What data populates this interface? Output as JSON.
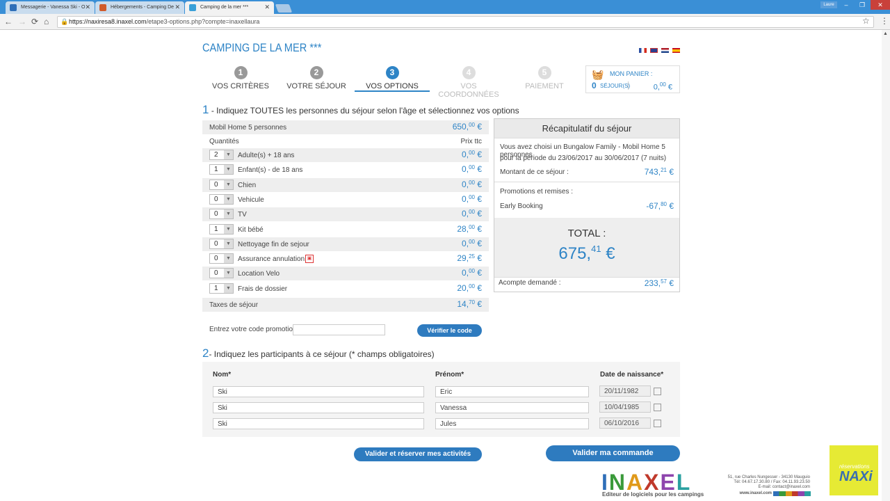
{
  "browser": {
    "tabs": [
      {
        "title": "Messagerie - Vanessa Ski - O",
        "color": "#2f6fb8"
      },
      {
        "title": "Hébergements - Camping De",
        "color": "#d05b2b"
      },
      {
        "title": "Camping de la mer ***",
        "color": "#3aa0d8"
      }
    ],
    "window_controls": [
      "Laure",
      "–",
      "❐",
      "✕"
    ],
    "url_host": "https://naxiresa8.inaxel.com",
    "url_path": "/etape3-options.php?compte=inaxellaura",
    "nav": {
      "back": "←",
      "forward": "→",
      "reload": "⟳",
      "home": "⌂",
      "star": "☆",
      "menu": "⋮"
    }
  },
  "page": {
    "title": "CAMPING DE LA MER ***",
    "flags": [
      "fr",
      "en",
      "nl",
      "es"
    ],
    "steps": [
      {
        "num": "1",
        "label": "VOS CRITÈRES",
        "state": "done"
      },
      {
        "num": "2",
        "label": "VOTRE SÉJOUR",
        "state": "done"
      },
      {
        "num": "3",
        "label": "VOS OPTIONS",
        "state": "current"
      },
      {
        "num": "4",
        "label": "VOS COORDONNÉES",
        "state": "off"
      },
      {
        "num": "5",
        "label": "PAIEMENT",
        "state": "off"
      }
    ],
    "cart": {
      "label": "MON PANIER :",
      "count": "0",
      "sejours": "SÉJOUR(S)",
      "price_int": "0,",
      "price_dec": "00",
      "currency": "€",
      "icon": "basket-icon"
    }
  },
  "section1": {
    "num": "1",
    "title": "- Indiquez TOUTES les personnes du séjour selon l'âge et sélectionnez vos options",
    "rental": {
      "label": "Mobil Home 5 personnes",
      "price_int": "650,",
      "price_dec": "00",
      "currency": "€"
    },
    "col_qty": "Quantités",
    "col_price": "Prix ttc",
    "options": [
      {
        "qty": "2",
        "label": "Adulte(s) + 18 ans",
        "price_int": "0,",
        "price_dec": "00"
      },
      {
        "qty": "1",
        "label": "Enfant(s) - de 18 ans",
        "price_int": "0,",
        "price_dec": "00"
      },
      {
        "qty": "0",
        "label": "Chien",
        "price_int": "0,",
        "price_dec": "00"
      },
      {
        "qty": "0",
        "label": "Vehicule",
        "price_int": "0,",
        "price_dec": "00"
      },
      {
        "qty": "0",
        "label": "TV",
        "price_int": "0,",
        "price_dec": "00"
      },
      {
        "qty": "1",
        "label": "Kit bébé",
        "price_int": "28,",
        "price_dec": "00"
      },
      {
        "qty": "0",
        "label": "Nettoyage fin de sejour",
        "price_int": "0,",
        "price_dec": "00"
      },
      {
        "qty": "0",
        "label": "Assurance annulation",
        "price_int": "29,",
        "price_dec": "25"
      },
      {
        "qty": "0",
        "label": "Location Velo",
        "price_int": "0,",
        "price_dec": "00"
      },
      {
        "qty": "1",
        "label": "Frais de dossier",
        "price_int": "20,",
        "price_dec": "00"
      }
    ],
    "taxes": {
      "label": "Taxes de séjour",
      "price_int": "14,",
      "price_dec": "70"
    },
    "currency": "€",
    "promo_label": "Entrez votre code promotion :",
    "promo_value": "",
    "promo_button": "Vérifier le code"
  },
  "recap": {
    "title": "Récapitulatif du séjour",
    "desc_line1": "Vous avez choisi un Bungalow Family - Mobil Home 5 personnes",
    "desc_line2": "pour la période du 23/06/2017 au 30/06/2017 (7 nuits)",
    "montant_label": "Montant de ce séjour :",
    "montant_int": "743,",
    "montant_dec": "21",
    "promos_label": "Promotions et remises :",
    "early_label": "Early Booking",
    "early_int": "-67,",
    "early_dec": "80",
    "total_label": "TOTAL :",
    "total_int": "675,",
    "total_dec": "41",
    "acompte_label": "Acompte demandé :",
    "acompte_int": "233,",
    "acompte_dec": "57",
    "currency": "€"
  },
  "section2": {
    "num": "2",
    "title": "- Indiquez les participants à ce séjour (* champs obligatoires)",
    "col_nom": "Nom*",
    "col_prenom": "Prénom*",
    "col_date": "Date de naissance*",
    "participants": [
      {
        "nom": "Ski",
        "prenom": "Eric",
        "date": "20/11/1982"
      },
      {
        "nom": "Ski",
        "prenom": "Vanessa",
        "date": "10/04/1985"
      },
      {
        "nom": "Ski",
        "prenom": "Jules",
        "date": "06/10/2016"
      }
    ]
  },
  "buttons": {
    "activities": "Valider et réserver mes activités",
    "order": "Valider ma commande"
  },
  "footer": {
    "logo": "INAXEL",
    "logo_colors": [
      "#2f6fb8",
      "#3a9a3a",
      "#e09a1a",
      "#c0392b",
      "#8e44ad",
      "#2aa0a0"
    ],
    "tagline": "Editeur de logiciels pour les campings",
    "address1": "51, rue Charles Nungesser - 34130 Mauguio",
    "address2": "Tél: 04.67.17.30.80 / Fax: 04.11.93.23.50",
    "address3": "E-mail: contact@inaxel.com",
    "website": "www.inaxel.com",
    "naxi_small": "réservations",
    "naxi_big": "NAXi"
  }
}
